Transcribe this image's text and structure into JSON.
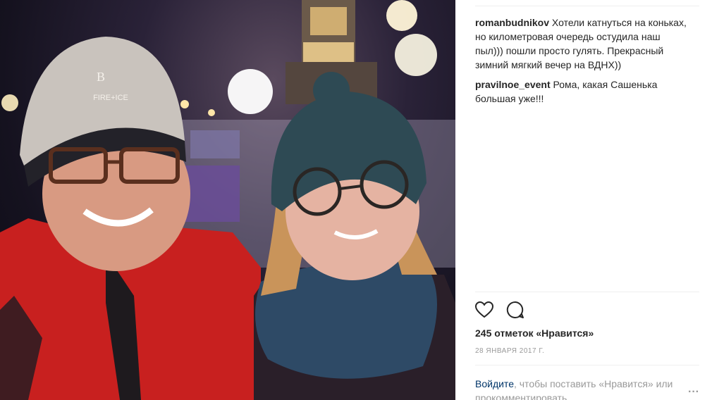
{
  "post": {
    "comments": [
      {
        "user": "romanbudnikov",
        "text": "Хотели катнуться на коньках, но километровая очередь остудила наш пыл))) пошли просто гулять. Прекрасный зимний мягкий вечер на ВДНХ))"
      },
      {
        "user": "pravilnoe_event",
        "text": "Рома, какая Сашенька большая уже!!!"
      }
    ],
    "likes_label": "245 отметок «Нравится»",
    "date": "28 ЯНВАРЯ 2017 Г.",
    "login_link": "Войдите",
    "login_text": ", чтобы поставить «Нравится» или прокомментировать.",
    "more_symbol": "···"
  },
  "photo": {
    "hat_brand_top": "B",
    "hat_brand": "FIRE+ICE"
  },
  "icons": {
    "like": "heart-icon",
    "comment": "comment-icon",
    "more": "more-options-icon"
  },
  "colors": {
    "link": "#003569",
    "muted": "#999999",
    "jacket_red": "#c8201f"
  }
}
